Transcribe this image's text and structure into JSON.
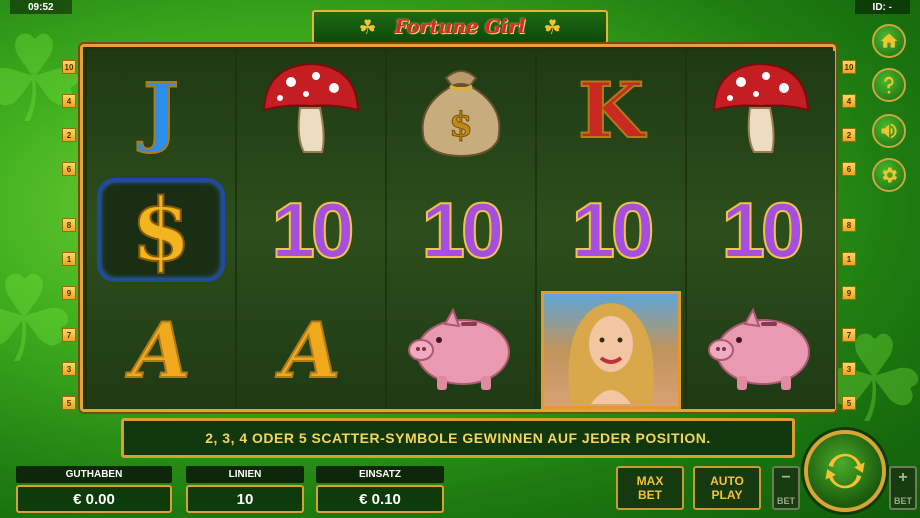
{
  "status": {
    "time": "09:52",
    "id": "ID: -"
  },
  "logo": {
    "title": "Fortune Girl"
  },
  "lines_left": [
    "10",
    "4",
    "2",
    "6",
    "8",
    "1",
    "9",
    "7",
    "3",
    "5"
  ],
  "lines_right": [
    "10",
    "4",
    "2",
    "6",
    "8",
    "1",
    "9",
    "7",
    "3",
    "5"
  ],
  "reels": [
    [
      {
        "type": "letter",
        "text": "J",
        "color": "blue"
      },
      {
        "type": "dollar",
        "text": "$"
      },
      {
        "type": "letter",
        "text": "A",
        "color": "gold"
      }
    ],
    [
      {
        "type": "mushroom"
      },
      {
        "type": "ten",
        "text": "10"
      },
      {
        "type": "letter",
        "text": "A",
        "color": "gold"
      }
    ],
    [
      {
        "type": "moneybag"
      },
      {
        "type": "ten",
        "text": "10"
      },
      {
        "type": "pig"
      }
    ],
    [
      {
        "type": "letter",
        "text": "K",
        "color": "red"
      },
      {
        "type": "ten",
        "text": "10"
      },
      {
        "type": "girl"
      }
    ],
    [
      {
        "type": "mushroom"
      },
      {
        "type": "ten",
        "text": "10"
      },
      {
        "type": "pig"
      }
    ]
  ],
  "message": "2, 3, 4 ODER 5 SCATTER-SYMBOLE GEWINNEN AUF JEDER POSITION.",
  "balance": {
    "label": "GUTHABEN",
    "value": "€ 0.00"
  },
  "lines": {
    "label": "LINIEN",
    "value": "10"
  },
  "stake": {
    "label": "EINSATZ",
    "value": "€ 0.10"
  },
  "maxbet": {
    "line1": "MAX",
    "line2": "BET"
  },
  "autoplay": {
    "line1": "AUTO",
    "line2": "PLAY"
  },
  "bet_minus": {
    "symbol": "−",
    "label": "BET"
  },
  "bet_plus": {
    "symbol": "+",
    "label": "BET"
  },
  "side_buttons": [
    "home-icon",
    "help-icon",
    "sound-icon",
    "settings-icon"
  ],
  "colors": {
    "frame_gold": "#e1a43a",
    "accent_yellow": "#f6c232",
    "ten_purple": "#a44fe0"
  }
}
